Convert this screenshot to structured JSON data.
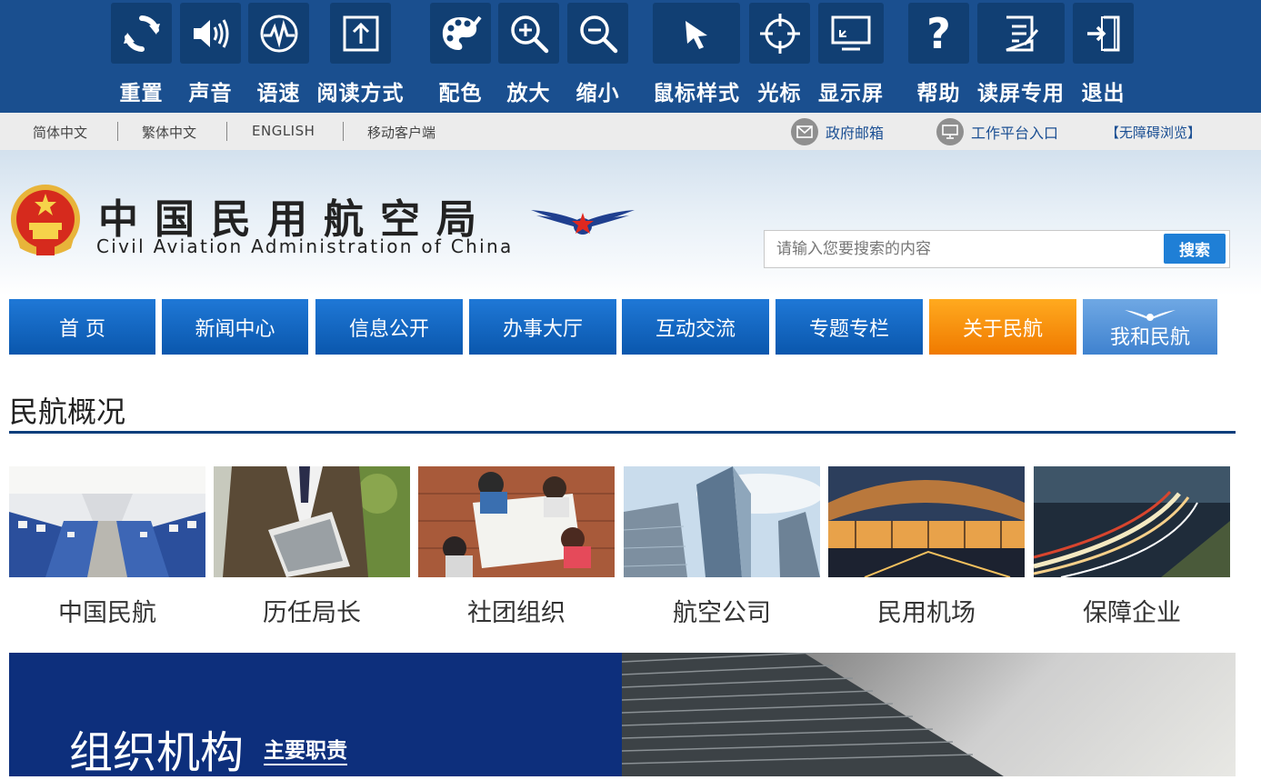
{
  "toolbar": {
    "tools": [
      {
        "id": "reset",
        "label": "重置",
        "icon": "reset-icon"
      },
      {
        "id": "sound",
        "label": "声音",
        "icon": "speaker-icon"
      },
      {
        "id": "speed",
        "label": "语速",
        "icon": "speed-icon"
      },
      {
        "id": "reading",
        "label": "阅读方式",
        "icon": "reading-mode-icon"
      },
      {
        "id": "color",
        "label": "配色",
        "icon": "palette-icon"
      },
      {
        "id": "zoomin",
        "label": "放大",
        "icon": "zoom-in-icon"
      },
      {
        "id": "zoomout",
        "label": "缩小",
        "icon": "zoom-out-icon"
      },
      {
        "id": "cursor",
        "label": "鼠标样式",
        "icon": "cursor-icon"
      },
      {
        "id": "crosshair",
        "label": "光标",
        "icon": "crosshair-icon"
      },
      {
        "id": "screen",
        "label": "显示屏",
        "icon": "screen-icon"
      },
      {
        "id": "help",
        "label": "帮助",
        "icon": "help-icon"
      },
      {
        "id": "reader",
        "label": "读屏专用",
        "icon": "screen-reader-icon"
      },
      {
        "id": "exit",
        "label": "退出",
        "icon": "exit-icon"
      }
    ]
  },
  "langbar": {
    "links": [
      "简体中文",
      "繁体中文",
      "ENGLISH",
      "移动客户端"
    ],
    "gov_mail": "政府邮箱",
    "work_platform": "工作平台入口",
    "accessible": "【无障碍浏览】"
  },
  "header": {
    "title_cn": "中国民用航空局",
    "title_en": "Civil Aviation Administration of China",
    "search_placeholder": "请输入您要搜索的内容",
    "search_button": "搜索"
  },
  "nav": {
    "items": [
      "首  页",
      "新闻中心",
      "信息公开",
      "办事大厅",
      "互动交流",
      "专题专栏",
      "关于民航",
      "我和民航"
    ],
    "active": "关于民航"
  },
  "section": {
    "title": "民航概况",
    "cards": [
      "中国民航",
      "历任局长",
      "社团组织",
      "航空公司",
      "民用机场",
      "保障企业"
    ]
  },
  "banner": {
    "title": "组织机构",
    "link": "主要职责"
  },
  "colors": {
    "toolbar_bg": "#1a4f8f",
    "nav_blue": "#0a57ad",
    "nav_active": "#f07a00",
    "section_rule": "#0c3e7c",
    "banner_bg": "#0d2f7c"
  }
}
